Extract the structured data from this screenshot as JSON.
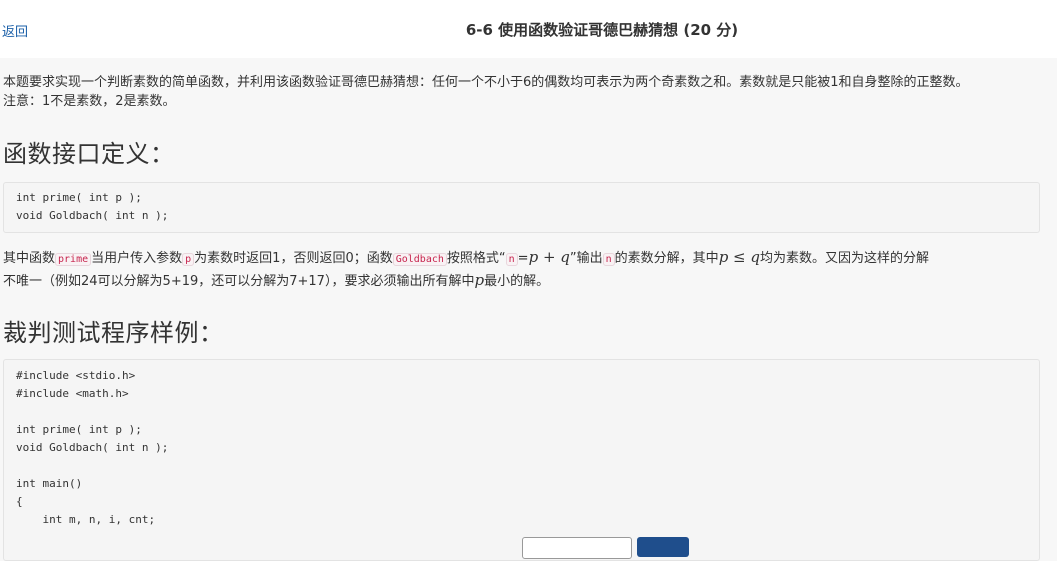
{
  "header": {
    "back_label": "返回",
    "title": "6-6 使用函数验证哥德巴赫猜想 (20 分)"
  },
  "intro": {
    "line1": "本题要求实现一个判断素数的简单函数，并利用该函数验证哥德巴赫猜想：任何一个不小于6的偶数均可表示为两个奇素数之和。素数就是只能被1和自身整除的正整数。",
    "line2": "注意：1不是素数，2是素数。"
  },
  "section_interface": {
    "heading": "函数接口定义：",
    "code": "int prime( int p );\nvoid Goldbach( int n );"
  },
  "description": {
    "p1": "其中函数",
    "code_prime": "prime",
    "p2": "当用户传入参数",
    "code_p": "p",
    "p3": "为素数时返回1，否则返回0；函数",
    "code_goldbach": "Goldbach",
    "p4": "按照格式“",
    "code_n1": "n",
    "p5": "=",
    "math1": "p + q",
    "p6": "”输出",
    "code_n2": "n",
    "p7": "的素数分解，其中",
    "math2": "p ≤ q",
    "p8": "均为素数。又因为这样的分解",
    "line2a": "不唯一（例如24可以分解为5+19，还可以分解为7+17），要求必须输出所有解中",
    "math3": "p",
    "line2b": "最小的解。"
  },
  "section_sample": {
    "heading": "裁判测试程序样例：",
    "code": "#include <stdio.h>\n#include <math.h>\n\nint prime( int p );\nvoid Goldbach( int n );\n\nint main()\n{\n    int m, n, i, cnt;"
  },
  "colors": {
    "link": "#1a5fa8",
    "inline_code": "#c7254e",
    "primary_button": "#1f4e8c"
  }
}
